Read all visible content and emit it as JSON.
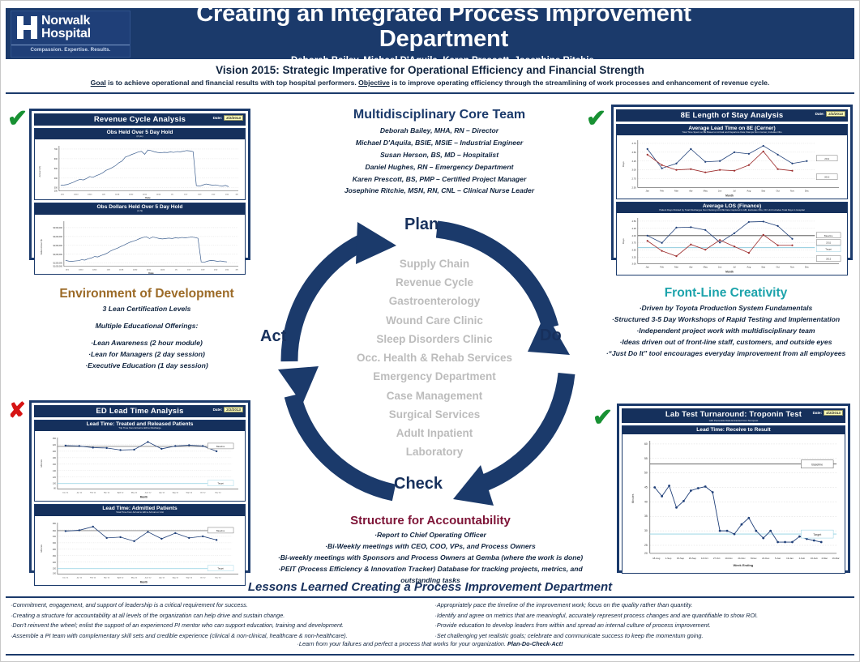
{
  "header": {
    "logo": {
      "line1": "Norwalk",
      "line2": "Hospital",
      "tagline": "Compassion. Expertise. Results."
    },
    "title": "Creating an Integrated Process Improvement Department",
    "authors": "Deborah Bailey, Michael D'Aquila, Karen Prescott, Josephine Ritchie."
  },
  "vision": {
    "title": "Vision 2015: Strategic Imperative for Operational Efficiency and Financial Strength",
    "goal_label": "Goal",
    "goal_text": " is to achieve operational and financial results with top hospital performers. ",
    "objective_label": "Objective",
    "objective_text": " is to improve operating efficiency through the streamlining of work processes and enhancement of revenue cycle."
  },
  "core_team": {
    "title": "Multidisciplinary Core Team",
    "members": [
      "Deborah Bailey, MHA, RN – Director",
      "Michael D'Aquila, BSIE, MSIE – Industrial Engineer",
      "Susan Herson, BS, MD – Hospitalist",
      "Daniel Hughes, RN – Emergency Department",
      "Karen Prescott, BS, PMP – Certified Project Manager",
      "Josephine Ritchie, MSN, RN, CNL – Clinical Nurse Leader"
    ]
  },
  "cycle": {
    "plan": "Plan",
    "do": "Do",
    "check": "Check",
    "act": "Act",
    "departments": [
      "Supply Chain",
      "Revenue Cycle",
      "Gastroenterology",
      "Wound Care Clinic",
      "Sleep Disorders Clinic",
      "Occ. Health & Rehab Services",
      "Emergency Department",
      "Case Management",
      "Surgical Services",
      "Adult Inpatient",
      "Laboratory"
    ]
  },
  "environment": {
    "title": "Environment of Development",
    "lines": [
      "3 Lean Certification Levels",
      "Multiple Educational Offerings:"
    ],
    "bullets": [
      "·Lean Awareness (2 hour module)",
      "·Lean for Managers (2 day session)",
      "·Executive Education (1 day session)"
    ]
  },
  "frontline": {
    "title": "Front-Line Creativity",
    "bullets": [
      "·Driven by Toyota Production System Fundamentals",
      "·Structured 3-5 Day Workshops of Rapid Testing and Implementation",
      "·Independent project work with multidisciplinary team",
      "·Ideas driven out of front-line staff, customers, and outside eyes",
      "·“Just Do It” tool encourages everyday improvement from all employees"
    ]
  },
  "accountability": {
    "title": "Structure for Accountability",
    "bullets": [
      "·Report to Chief Operating Officer",
      "·Bi-Weekly meetings with CEO, COO, VPs, and Process Owners",
      "·Bi-weekly meetings with Sponsors and Process Owners at Gemba (where the work is done)",
      "·PEIT (Process Efficiency & Innovation Tracker)  Database for tracking projects, metrics, and",
      "outstanding tasks"
    ]
  },
  "lessons": {
    "title": "Lessons Learned Creating a Process Improvement Department",
    "left": [
      "·Commitment, engagement, and support of leadership is a critical requirement for success.",
      "·Creating a structure for accountability at all levels of the organization can help drive and sustain change.",
      "·Don't reinvent the wheel; enlist the support of an experienced PI mentor who can support education, training and development.",
      "·Assemble a PI team with complementary skill sets and credible experience (clinical & non-clinical,  healthcare & non-healthcare)."
    ],
    "right": [
      "·Appropriately pace the timeline of the improvement work; focus on the quality rather than quantity.",
      "·Identify and agree on metrics that are meaningful, accurately represent process changes and are quantifiable to show ROI.",
      "·Provide education to develop leaders from within and spread an internal culture of process improvement.",
      "·Set challenging yet realistic goals; celebrate and communicate success to keep the momentum going."
    ],
    "footer_text": "·Learn from your failures and perfect a process that works for your organization.  ",
    "footer_bold": "Plan-Do-Check-Act!"
  },
  "marks": {
    "ok": "✔",
    "no": "✘"
  },
  "panels": {
    "revenue": {
      "title": "Revenue Cycle Analysis",
      "date_label": "Date:",
      "date_value": "2/2/2013",
      "status": "ok"
    },
    "los": {
      "title": "8E Length of Stay Analysis",
      "date_label": "Date:",
      "date_value": "2/2/2013",
      "status": "ok"
    },
    "ed": {
      "title": "ED Lead Time Analysis",
      "date_label": "Date:",
      "date_value": "2/2/2013",
      "status": "no"
    },
    "lab": {
      "title": "Lab Test Turnaround: Troponin Test",
      "subtitle": "with Percentile Data Extracted from Sunquest",
      "date_label": "Date:",
      "date_value": "4/2/2013",
      "status": "ok"
    }
  },
  "chart_data": [
    {
      "type": "line",
      "id": "obs-held",
      "title": "Obs Held Over 5 Day Hold",
      "subtitle": "(# pts)",
      "xlabel": "Date",
      "ylabel": "Amount (#)",
      "ylim": [
        200,
        700
      ],
      "yticks": [
        200,
        300,
        400,
        500,
        600,
        700
      ],
      "xticks": [
        "10/1",
        "10/13",
        "10/25",
        "11/6",
        "11/18",
        "11/30",
        "12/12",
        "12/24",
        "1/5",
        "1/17",
        "1/29",
        "2/10",
        "2/22",
        "3/6"
      ],
      "series": [
        {
          "name": "Obs Held",
          "values": [
            300,
            302,
            305,
            318,
            330,
            345,
            360,
            352,
            368,
            390,
            382,
            400,
            412,
            430,
            455,
            470,
            490,
            510,
            540,
            560,
            600,
            612,
            628,
            640,
            655,
            662,
            630,
            680,
            672,
            660,
            650,
            645,
            650,
            648,
            655,
            650,
            660,
            658,
            665,
            672,
            668,
            660,
            300,
            292,
            305,
            318,
            310,
            305,
            308,
            300,
            292
          ]
        }
      ]
    },
    {
      "type": "line",
      "id": "obs-dollars",
      "title": "Obs Dollars Held Over 5 Day Hold",
      "subtitle": "(in $)",
      "xlabel": "Date",
      "ylabel": "Dollar Amount $",
      "ylim": [
        1000000,
        3500000
      ],
      "yticks": [
        "$1,000,000",
        "$1,500,000",
        "$2,000,000",
        "$2,500,000",
        "$3,000,000",
        "$3,500,000"
      ],
      "xticks": [
        "10/1",
        "10/13",
        "10/25",
        "11/6",
        "11/18",
        "11/30",
        "12/12",
        "12/24",
        "1/5",
        "1/17",
        "1/29",
        "2/10",
        "2/22",
        "3/6"
      ],
      "series": [
        {
          "name": "Obs Dollars",
          "values": [
            1480000,
            1440000,
            1430000,
            1450000,
            1470000,
            1520000,
            1500000,
            1580000,
            1620000,
            1700000,
            1680000,
            1760000,
            1820000,
            1900000,
            2020000,
            2100000,
            2160000,
            2250000,
            2330000,
            2420000,
            2500000,
            2560000,
            2620000,
            2700000,
            2760000,
            2800000,
            2700000,
            2780000,
            2750000,
            2700000,
            2680000,
            2700000,
            2720000,
            2700000,
            2740000,
            2720000,
            2760000,
            2740000,
            2760000,
            2780000,
            2760000,
            2720000,
            1400000,
            1380000,
            1440000,
            1480000,
            1460000,
            1430000,
            1450000,
            1420000,
            1400000
          ]
        }
      ]
    },
    {
      "type": "line",
      "id": "avg-lead-time-8e",
      "title": "Average Lead Time on 8E (Cerner)",
      "subtitle": "Total Time Spent on 8E Based on Arrival and Departure Date Stamps from Cerner, Includes Obs",
      "xlabel": "Month",
      "ylabel": "Days",
      "ylim": [
        2.5,
        3.75
      ],
      "yticks": [
        "2.50",
        "2.75",
        "3.00",
        "3.25",
        "3.50",
        "3.75"
      ],
      "categories": [
        "Jan",
        "Feb",
        "Mar",
        "Apr",
        "May",
        "Jun",
        "Jul",
        "Aug",
        "Sep",
        "Oct",
        "Nov",
        "Dec"
      ],
      "series": [
        {
          "name": "2011",
          "color": "#1f3f78",
          "values": [
            3.56,
            3.02,
            3.17,
            3.56,
            3.22,
            3.25,
            3.5,
            3.46,
            3.67,
            3.41,
            3.18,
            3.24
          ]
        },
        {
          "name": "2012",
          "color": "#9c2b2b",
          "values": [
            3.39,
            3.1,
            3.0,
            3.01,
            2.92,
            2.99,
            2.97,
            3.1,
            3.51,
            3.04,
            2.96,
            null
          ]
        }
      ]
    },
    {
      "type": "line",
      "id": "avg-los-finance",
      "title": "Average LOS (Finance)",
      "subtitle": "Patient Days Divided by Total Discharges from Nursing Unit 8E Data Captured in HB, Excludes Obs, OC Unit Includes Total Days in Hospital",
      "xlabel": "Month",
      "ylabel": "Days",
      "ylim": [
        3.0,
        4.5
      ],
      "yticks": [
        "3.00",
        "3.25",
        "3.50",
        "3.75",
        "4.00",
        "4.25",
        "4.50"
      ],
      "categories": [
        "Jan",
        "Feb",
        "Mar",
        "Apr",
        "May",
        "Jun",
        "Jul",
        "Aug",
        "Sep",
        "Oct",
        "Nov",
        "Dec"
      ],
      "reference_lines": [
        {
          "name": "Baseline",
          "value": 4.0
        },
        {
          "name": "Target",
          "value": 3.58
        }
      ],
      "series": [
        {
          "name": "2011",
          "color": "#1f3f78",
          "values": [
            4.0,
            3.76,
            4.22,
            4.23,
            4.15,
            3.79,
            4.08,
            4.46,
            4.48,
            4.33,
            3.88,
            null
          ]
        },
        {
          "name": "2012",
          "color": "#9c2b2b",
          "values": [
            3.82,
            3.47,
            3.27,
            3.7,
            3.53,
            3.86,
            3.63,
            3.44,
            4.03,
            3.66,
            3.66,
            null
          ]
        }
      ]
    },
    {
      "type": "line",
      "id": "ed-treated-released",
      "title": "Lead Time: Treated and Released Patients",
      "subtitle": "Trip Time from Arrival to ED to Discharge",
      "xlabel": "Month",
      "ylabel": "Minutes",
      "ylim": [
        80,
        250
      ],
      "yticks": [
        "80",
        "100",
        "120",
        "140",
        "160",
        "180",
        "200",
        "220",
        "250"
      ],
      "categories": [
        "Dec '11",
        "Jan '12",
        "Feb '12",
        "Mar '12",
        "April '12",
        "May '12",
        "June '12",
        "July '12",
        "Aug '12",
        "Sept '12",
        "Oct '12",
        "Nov '12"
      ],
      "reference_lines": [
        {
          "name": "Baseline",
          "value": 209
        },
        {
          "name": "Target",
          "value": 96
        }
      ],
      "series": [
        {
          "name": "Treated & Released",
          "color": "#1f3f78",
          "values": [
            212,
            211,
            205,
            204,
            196,
            197,
            227,
            200,
            211,
            214,
            210,
            191
          ]
        }
      ]
    },
    {
      "type": "line",
      "id": "ed-admitted",
      "title": "Lead Time: Admitted Patients",
      "subtitle": "Total Time from Arrival to ED to Arrival on Unit",
      "xlabel": "Month",
      "ylabel": "Minutes",
      "ylim": [
        100,
        380
      ],
      "yticks": [
        "100",
        "150",
        "200",
        "250",
        "300",
        "330",
        "360",
        "380"
      ],
      "categories": [
        "Dec '11",
        "Jan '12",
        "Feb '12",
        "Mar '12",
        "April '12",
        "May '12",
        "June '12",
        "July '12",
        "Aug '12",
        "Sept '12",
        "Oct '12",
        "Nov '12"
      ],
      "reference_lines": [
        {
          "name": "Baseline",
          "value": 355
        },
        {
          "name": "Target",
          "value": 150
        }
      ],
      "series": [
        {
          "name": "Admitted",
          "color": "#1f3f78",
          "values": [
            356,
            358,
            366,
            338,
            340,
            330,
            354,
            337,
            352,
            340,
            345,
            335
          ]
        }
      ]
    },
    {
      "type": "line",
      "id": "troponin-lead-time",
      "title": "Lead Time: Receive to Result",
      "xlabel": "Week Ending",
      "ylabel": "Minutes",
      "ylim": [
        20,
        60
      ],
      "yticks": [
        "20",
        "25",
        "30",
        "35",
        "40",
        "45",
        "50",
        "55",
        "60"
      ],
      "categories": [
        "18-Aug",
        "1-Sep",
        "15-Sep",
        "29-Sep",
        "13-Oct",
        "27-Oct",
        "10-Nov",
        "24-Nov",
        "8-Dec",
        "22-Dec",
        "5-Jan",
        "19-Jan",
        "2-Feb",
        "16-Feb",
        "2-Mar",
        "16-Mar"
      ],
      "reference_lines": [
        {
          "name": "Baseline",
          "value": 53
        },
        {
          "name": "Target",
          "value": 25
        }
      ],
      "series": [
        {
          "name": "Receive to Result",
          "color": "#1f3f78",
          "values": [
            50,
            47,
            50.5,
            43.5,
            46,
            48.5,
            49,
            50,
            48,
            26,
            26,
            25,
            27.5,
            29,
            25,
            23,
            25,
            22,
            22,
            22,
            24,
            23.5,
            23,
            22
          ]
        }
      ]
    }
  ]
}
